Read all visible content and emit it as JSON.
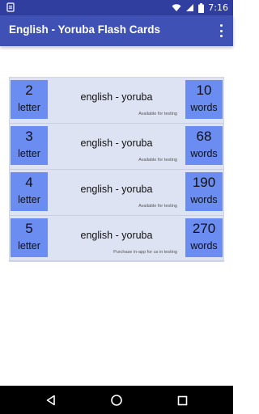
{
  "status_bar": {
    "time": "7:16",
    "icons": [
      "notification-icon",
      "wifi-icon",
      "signal-icon",
      "battery-icon"
    ]
  },
  "app_bar": {
    "title": "English - Yoruba Flash Cards",
    "menu_icon": "overflow-menu-icon"
  },
  "cards": [
    {
      "letters": "2",
      "letters_unit": "letter",
      "title": "english - yoruba",
      "note": "Available for testing",
      "words": "10",
      "words_unit": "words"
    },
    {
      "letters": "3",
      "letters_unit": "letter",
      "title": "english - yoruba",
      "note": "Available for testing",
      "words": "68",
      "words_unit": "words"
    },
    {
      "letters": "4",
      "letters_unit": "letter",
      "title": "english - yoruba",
      "note": "Available for testing",
      "words": "190",
      "words_unit": "words"
    },
    {
      "letters": "5",
      "letters_unit": "letter",
      "title": "english - yoruba",
      "note": "Purchase in-app for us in testing",
      "words": "270",
      "words_unit": "words"
    }
  ],
  "nav_bar": {
    "buttons": [
      "back-icon",
      "home-icon",
      "recents-icon"
    ]
  },
  "colors": {
    "status_bar": "#303f9f",
    "app_bar": "#3f51b5",
    "card_bg": "#dde3f3",
    "number_box": "#6b8cf0"
  }
}
